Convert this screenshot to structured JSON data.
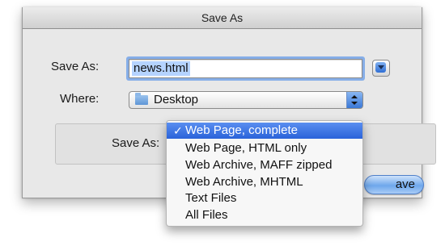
{
  "dialog": {
    "title": "Save As",
    "name_label": "Save As:",
    "filename": "news.html",
    "where_label": "Where:",
    "where_value": "Desktop",
    "format_label": "Save As:",
    "save_button_label": "Save",
    "save_button_visible": "ave",
    "format_menu": {
      "checkmark": "✓",
      "items": [
        {
          "label": "Web Page, complete"
        },
        {
          "label": "Web Page, HTML only"
        },
        {
          "label": "Web Archive, MAFF zipped"
        },
        {
          "label": "Web Archive, MHTML"
        },
        {
          "label": "Text Files"
        },
        {
          "label": "All Files"
        }
      ]
    }
  },
  "colors": {
    "selection_highlight": "#2a63d9",
    "text_selection": "#b5d3ff",
    "default_button": "#6ea7ec",
    "window_bg": "#e8e8e8"
  },
  "icons": {
    "expand": "disclosure-triangle",
    "folder": "folder-icon",
    "stepper": "up-down-arrows",
    "check": "checkmark"
  }
}
